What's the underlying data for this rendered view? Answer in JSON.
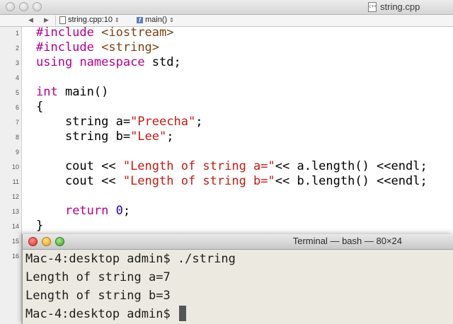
{
  "editor": {
    "window_title": "string.cpp",
    "document_icon": "c++-source-file-icon",
    "jumpbar": {
      "back_arrow": "◀",
      "forward_arrow": "▶",
      "file_crumb": "string.cpp:10",
      "function_crumb": "main()",
      "updown": "⇕"
    }
  },
  "code": {
    "line_numbers": [
      "1",
      "2",
      "3",
      "4",
      "5",
      "6",
      "7",
      "8",
      "9",
      "10",
      "11",
      "12",
      "13",
      "14",
      "15",
      "16"
    ],
    "lines": [
      "#include <iostream>",
      "#include <string>",
      "using namespace std;",
      "",
      "int main()",
      "{",
      "    string a=\"Preecha\";",
      "    string b=\"Lee\";",
      "",
      "    cout << \"Length of string a=\"<< a.length() <<endl;",
      "    cout << \"Length of string b=\"<< b.length() <<endl;",
      "",
      "    return 0;",
      "}"
    ]
  },
  "terminal": {
    "title": "Terminal — bash — 80×24",
    "lines": [
      "Mac-4:desktop admin$ ./string",
      "Length of string a=7",
      "Length of string b=3",
      "Mac-4:desktop admin$ "
    ]
  }
}
